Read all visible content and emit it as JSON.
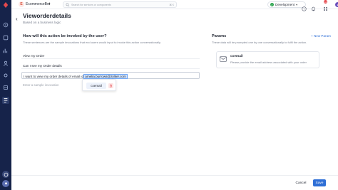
{
  "topbar": {
    "bot_initial": "E",
    "bot_name": "EcommerceBot",
    "search_placeholder": "Search for services or components",
    "search_shortcut": "⌘ K",
    "environment": "Development",
    "notifications_count": "12"
  },
  "header": {
    "title": "Vieworderdetails",
    "subtitle": "Based on a business logic"
  },
  "invocations": {
    "title": "How will this action be invoked by the user?",
    "description": "These sentences are the sample invocations that end users would input to invoke this action conversationally.",
    "items": [
      {
        "text": "View my Order"
      },
      {
        "text": "Can I see my Order details"
      },
      {
        "prefix": "I want to view my order details of email id ",
        "highlight": "amelia.burrows@zylker.com"
      }
    ],
    "input_placeholder": "Enter a sample invocation",
    "popover": {
      "param": "cxemail"
    }
  },
  "params": {
    "title": "Params",
    "description": "These data will be prompted one by one conversationally to fulfil the action.",
    "new_label": "+ New Param",
    "items": [
      {
        "name": "cxemail",
        "description": "Please provide the email address associated with your order"
      }
    ]
  },
  "footer": {
    "cancel_label": "Cancel",
    "save_label": "Save"
  },
  "colors": {
    "sidebar": "#16234a",
    "accent": "#2f6fd6",
    "env_dot": "#2ea44f",
    "badge": "#e5484d"
  }
}
